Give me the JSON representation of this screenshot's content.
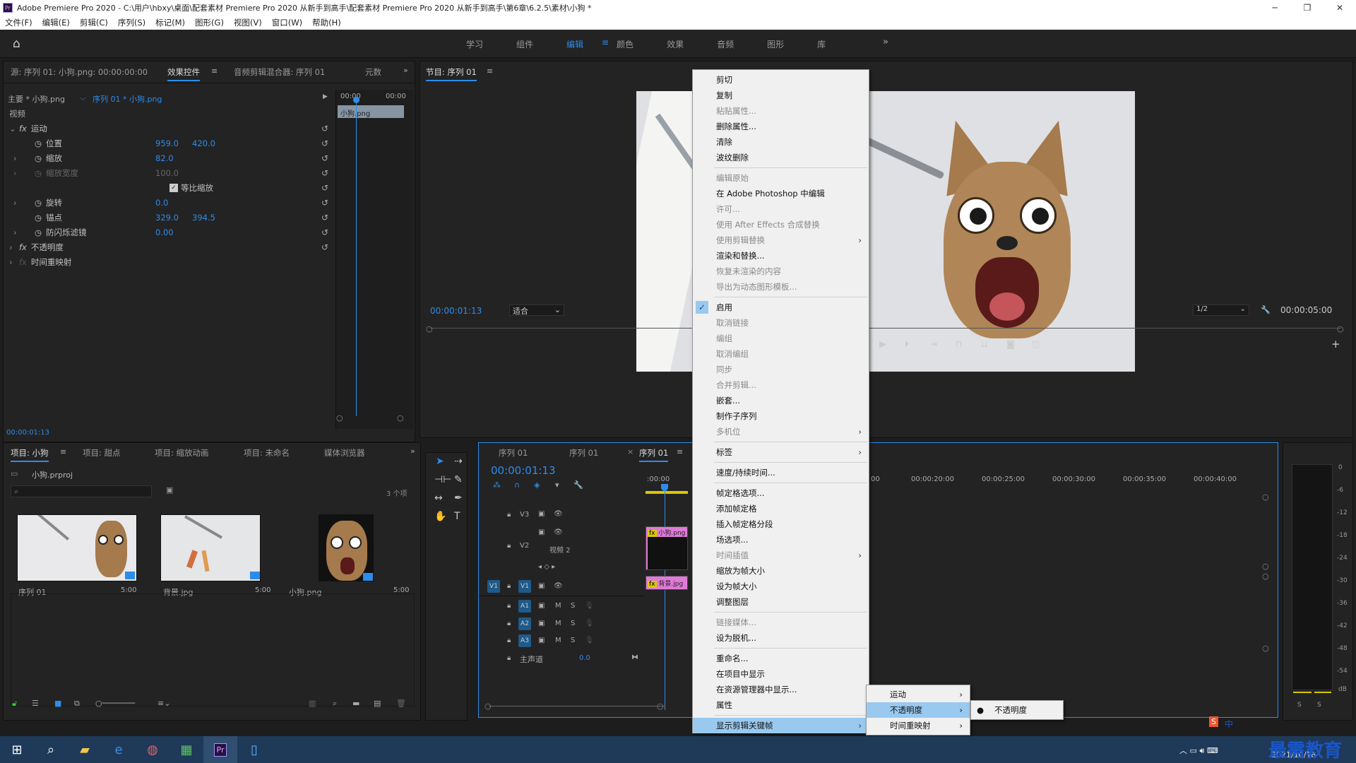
{
  "title_bar": {
    "title": "Adobe Premiere Pro 2020 - C:\\用户\\hbxy\\桌面\\配套素材 Premiere Pro 2020 从新手到高手\\配套素材 Premiere Pro 2020 从新手到高手\\第6章\\6.2.5\\素材\\小狗 *",
    "app_badge": "Pr"
  },
  "menu": [
    "文件(F)",
    "编辑(E)",
    "剪辑(C)",
    "序列(S)",
    "标记(M)",
    "图形(G)",
    "视图(V)",
    "窗口(W)",
    "帮助(H)"
  ],
  "workspaces": [
    "学习",
    "组件",
    "编辑",
    "颜色",
    "效果",
    "音频",
    "图形",
    "库"
  ],
  "active_workspace": "编辑",
  "effect_controls": {
    "tabs": [
      "源: 序列 01: 小狗.png: 00:00:00:00",
      "效果控件",
      "音频剪辑混合器: 序列 01",
      "元数"
    ],
    "master": "主要 * 小狗.png",
    "clip": "序列 01 * 小狗.png",
    "ruler": [
      "00:00",
      "00:00"
    ],
    "clip_label": "小狗.png",
    "section": "视频",
    "motion": "运动",
    "props": [
      {
        "name": "位置",
        "v1": "959.0",
        "v2": "420.0"
      },
      {
        "name": "缩放",
        "v1": "82.0",
        "v2": ""
      },
      {
        "name": "缩放宽度",
        "v1": "100.0",
        "v2": ""
      },
      {
        "name": "等比缩放",
        "v1": "",
        "v2": ""
      },
      {
        "name": "旋转",
        "v1": "0.0",
        "v2": ""
      },
      {
        "name": "锚点",
        "v1": "329.0",
        "v2": "394.5"
      },
      {
        "name": "防闪烁滤镜",
        "v1": "0.00",
        "v2": ""
      }
    ],
    "opacity": "不透明度",
    "time_remap": "时间重映射",
    "timecode": "00:00:01:13"
  },
  "program": {
    "title": "节目: 序列 01",
    "timecode": "00:00:01:13",
    "fit": "适合",
    "quality": "1/2",
    "duration": "00:00:05:00"
  },
  "project": {
    "tabs": [
      "项目: 小狗",
      "项目: 甜点",
      "项目: 缩放动画",
      "项目: 未命名",
      "媒体浏览器"
    ],
    "file": "小狗.prproj",
    "count": "3 个项",
    "items": [
      {
        "name": "序列 01",
        "dur": "5:00"
      },
      {
        "name": "背景.jpg",
        "dur": "5:00"
      },
      {
        "name": "小狗.png",
        "dur": "5:00"
      }
    ]
  },
  "timeline": {
    "tabs": [
      "序列 01",
      "序列 01",
      "序列 01"
    ],
    "timecode": "00:00:01:13",
    "ruler": [
      ":00:00",
      "00:00:20:00",
      "00:00:25:00",
      "00:00:30:00",
      "00:00:35:00",
      "00:00:40:00",
      "00"
    ],
    "tracks": {
      "v3": "V3",
      "v2": "V2",
      "v2name": "视频 2",
      "v1": "V1",
      "a1": "A1",
      "a2": "A2",
      "a3": "A3",
      "master": "主声道",
      "master_val": "0.0",
      "m": "M",
      "s": "S"
    },
    "clips": {
      "v2": "小狗.png",
      "v1": "背景.jpg"
    }
  },
  "context_menu": [
    {
      "t": "剪切"
    },
    {
      "t": "复制"
    },
    {
      "t": "粘贴属性...",
      "d": true
    },
    {
      "t": "删除属性..."
    },
    {
      "t": "清除"
    },
    {
      "t": "波纹删除"
    },
    {
      "sep": true
    },
    {
      "t": "编辑原始",
      "d": true
    },
    {
      "t": "在 Adobe Photoshop 中编辑"
    },
    {
      "t": "许可...",
      "d": true
    },
    {
      "t": "使用 After Effects 合成替换",
      "d": true
    },
    {
      "t": "使用剪辑替换",
      "d": true,
      "sub": true
    },
    {
      "t": "渲染和替换..."
    },
    {
      "t": "恢复未渲染的内容",
      "d": true
    },
    {
      "t": "导出为动态图形模板...",
      "d": true
    },
    {
      "sep": true
    },
    {
      "t": "启用",
      "chk": true
    },
    {
      "t": "取消链接",
      "d": true
    },
    {
      "t": "编组",
      "d": true
    },
    {
      "t": "取消编组",
      "d": true
    },
    {
      "t": "同步",
      "d": true
    },
    {
      "t": "合并剪辑...",
      "d": true
    },
    {
      "t": "嵌套..."
    },
    {
      "t": "制作子序列"
    },
    {
      "t": "多机位",
      "d": true,
      "sub": true
    },
    {
      "sep": true
    },
    {
      "t": "标签",
      "sub": true
    },
    {
      "sep": true
    },
    {
      "t": "速度/持续时间..."
    },
    {
      "sep": true
    },
    {
      "t": "帧定格选项..."
    },
    {
      "t": "添加帧定格"
    },
    {
      "t": "插入帧定格分段"
    },
    {
      "t": "场选项..."
    },
    {
      "t": "时间插值",
      "d": true,
      "sub": true
    },
    {
      "t": "缩放为帧大小"
    },
    {
      "t": "设为帧大小"
    },
    {
      "t": "调整图层"
    },
    {
      "sep": true
    },
    {
      "t": "链接媒体...",
      "d": true
    },
    {
      "t": "设为脱机..."
    },
    {
      "sep": true
    },
    {
      "t": "重命名..."
    },
    {
      "t": "在项目中显示"
    },
    {
      "t": "在资源管理器中显示..."
    },
    {
      "t": "属性"
    },
    {
      "sep": true
    },
    {
      "t": "显示剪辑关键帧",
      "sub": true,
      "sel": true
    }
  ],
  "submenu1": [
    {
      "t": "运动"
    },
    {
      "t": "不透明度",
      "sel": true
    },
    {
      "t": "时间重映射"
    }
  ],
  "submenu2": [
    {
      "t": "不透明度"
    }
  ],
  "meter": [
    "0",
    "-6",
    "-12",
    "-18",
    "-24",
    "-30",
    "-36",
    "-42",
    "-48",
    "-54",
    "dB"
  ],
  "taskbar": {
    "date": "2021/10/18",
    "watermark": "最需教育",
    "ime": "中"
  }
}
